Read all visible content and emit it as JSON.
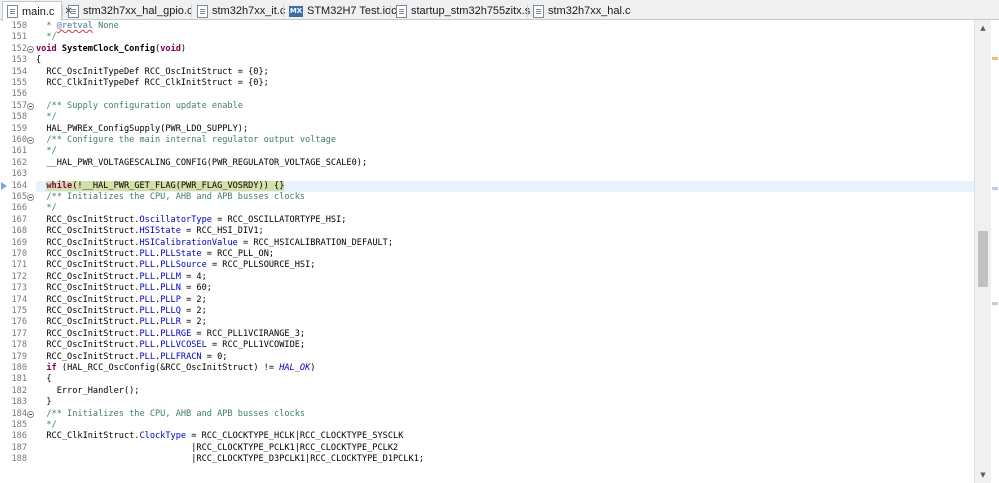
{
  "tabs": [
    {
      "label": "main.c",
      "icon": "c-file-icon",
      "active": true,
      "close": "✕"
    },
    {
      "label": "stm32h7xx_hal_gpio.c",
      "icon": "c-file-icon",
      "active": false
    },
    {
      "label": "stm32h7xx_it.c",
      "icon": "c-file-icon",
      "active": false
    },
    {
      "label": "STM32H7 Test.ioc",
      "icon": "mx-icon",
      "badge": "MX",
      "active": false
    },
    {
      "label": "startup_stm32h755zitx.s",
      "icon": "asm-file-icon",
      "active": false
    },
    {
      "label": "stm32h7xx_hal.c",
      "icon": "c-file-icon",
      "active": false
    }
  ],
  "editor": {
    "current_line": 164,
    "colors": {
      "keyword": "#7f0055",
      "comment": "#3f7f5f",
      "field": "#0000c0",
      "current_line_bg": "#e8f2fe",
      "match_highlight": "#d4e0a8"
    },
    "lines": [
      {
        "n": "150",
        "fold": false,
        "tokens": [
          {
            "t": "  * ",
            "c": "cm"
          },
          {
            "t": "@retval",
            "c": "ann"
          },
          {
            "t": " None",
            "c": "cm"
          }
        ]
      },
      {
        "n": "151",
        "fold": false,
        "tokens": [
          {
            "t": "  */",
            "c": "cm"
          }
        ]
      },
      {
        "n": "152",
        "fold": true,
        "tokens": [
          {
            "t": "void",
            "c": "kw"
          },
          {
            "t": " "
          },
          {
            "t": "SystemClock_Config",
            "c": "bold"
          },
          {
            "t": "("
          },
          {
            "t": "void",
            "c": "kw"
          },
          {
            "t": ")"
          }
        ]
      },
      {
        "n": "153",
        "fold": false,
        "tokens": [
          {
            "t": "{"
          }
        ]
      },
      {
        "n": "154",
        "fold": false,
        "tokens": [
          {
            "t": "  RCC_OscInitTypeDef RCC_OscInitStruct = {0};"
          }
        ]
      },
      {
        "n": "155",
        "fold": false,
        "tokens": [
          {
            "t": "  RCC_ClkInitTypeDef RCC_ClkInitStruct = {0};"
          }
        ]
      },
      {
        "n": "156",
        "fold": false,
        "tokens": [
          {
            "t": ""
          }
        ]
      },
      {
        "n": "157",
        "fold": true,
        "tokens": [
          {
            "t": "  /** Supply configuration update enable",
            "c": "cm"
          }
        ]
      },
      {
        "n": "158",
        "fold": false,
        "tokens": [
          {
            "t": "  */",
            "c": "cm"
          }
        ]
      },
      {
        "n": "159",
        "fold": false,
        "tokens": [
          {
            "t": "  HAL_PWREx_ConfigSupply(PWR_LDO_SUPPLY);"
          }
        ]
      },
      {
        "n": "160",
        "fold": true,
        "tokens": [
          {
            "t": "  /** Configure the main internal regulator output voltage",
            "c": "cm"
          }
        ]
      },
      {
        "n": "161",
        "fold": false,
        "tokens": [
          {
            "t": "  */",
            "c": "cm"
          }
        ]
      },
      {
        "n": "162",
        "fold": false,
        "tokens": [
          {
            "t": "  __HAL_PWR_VOLTAGESCALING_CONFIG(PWR_REGULATOR_VOLTAGE_SCALE0);"
          }
        ]
      },
      {
        "n": "163",
        "fold": false,
        "tokens": [
          {
            "t": ""
          }
        ]
      },
      {
        "n": "164",
        "fold": false,
        "current": true,
        "tokens": [
          {
            "t": "  "
          },
          {
            "t": "while",
            "c": "kw hl"
          },
          {
            "t": "(!__HAL_PWR_GET_FLAG(PWR_FLAG_VOSRDY)) {}",
            "c": "hl"
          }
        ]
      },
      {
        "n": "165",
        "fold": true,
        "tokens": [
          {
            "t": "  /** Initializes the CPU, AHB and APB busses clocks",
            "c": "cm"
          }
        ]
      },
      {
        "n": "166",
        "fold": false,
        "tokens": [
          {
            "t": "  */",
            "c": "cm"
          }
        ]
      },
      {
        "n": "167",
        "fold": false,
        "tokens": [
          {
            "t": "  RCC_OscInitStruct."
          },
          {
            "t": "OscillatorType",
            "c": "fld"
          },
          {
            "t": " = RCC_OSCILLATORTYPE_HSI;"
          }
        ]
      },
      {
        "n": "168",
        "fold": false,
        "tokens": [
          {
            "t": "  RCC_OscInitStruct."
          },
          {
            "t": "HSIState",
            "c": "fld"
          },
          {
            "t": " = RCC_HSI_DIV1;"
          }
        ]
      },
      {
        "n": "169",
        "fold": false,
        "tokens": [
          {
            "t": "  RCC_OscInitStruct."
          },
          {
            "t": "HSICalibrationValue",
            "c": "fld"
          },
          {
            "t": " = RCC_HSICALIBRATION_DEFAULT;"
          }
        ]
      },
      {
        "n": "170",
        "fold": false,
        "tokens": [
          {
            "t": "  RCC_OscInitStruct."
          },
          {
            "t": "PLL",
            "c": "fld"
          },
          {
            "t": "."
          },
          {
            "t": "PLLState",
            "c": "fld"
          },
          {
            "t": " = RCC_PLL_ON;"
          }
        ]
      },
      {
        "n": "171",
        "fold": false,
        "tokens": [
          {
            "t": "  RCC_OscInitStruct."
          },
          {
            "t": "PLL",
            "c": "fld"
          },
          {
            "t": "."
          },
          {
            "t": "PLLSource",
            "c": "fld"
          },
          {
            "t": " = RCC_PLLSOURCE_HSI;"
          }
        ]
      },
      {
        "n": "172",
        "fold": false,
        "tokens": [
          {
            "t": "  RCC_OscInitStruct."
          },
          {
            "t": "PLL",
            "c": "fld"
          },
          {
            "t": "."
          },
          {
            "t": "PLLM",
            "c": "fld"
          },
          {
            "t": " = 4;"
          }
        ]
      },
      {
        "n": "173",
        "fold": false,
        "tokens": [
          {
            "t": "  RCC_OscInitStruct."
          },
          {
            "t": "PLL",
            "c": "fld"
          },
          {
            "t": "."
          },
          {
            "t": "PLLN",
            "c": "fld"
          },
          {
            "t": " = 60;"
          }
        ]
      },
      {
        "n": "174",
        "fold": false,
        "tokens": [
          {
            "t": "  RCC_OscInitStruct."
          },
          {
            "t": "PLL",
            "c": "fld"
          },
          {
            "t": "."
          },
          {
            "t": "PLLP",
            "c": "fld"
          },
          {
            "t": " = 2;"
          }
        ]
      },
      {
        "n": "175",
        "fold": false,
        "tokens": [
          {
            "t": "  RCC_OscInitStruct."
          },
          {
            "t": "PLL",
            "c": "fld"
          },
          {
            "t": "."
          },
          {
            "t": "PLLQ",
            "c": "fld"
          },
          {
            "t": " = 2;"
          }
        ]
      },
      {
        "n": "176",
        "fold": false,
        "tokens": [
          {
            "t": "  RCC_OscInitStruct."
          },
          {
            "t": "PLL",
            "c": "fld"
          },
          {
            "t": "."
          },
          {
            "t": "PLLR",
            "c": "fld"
          },
          {
            "t": " = 2;"
          }
        ]
      },
      {
        "n": "177",
        "fold": false,
        "tokens": [
          {
            "t": "  RCC_OscInitStruct."
          },
          {
            "t": "PLL",
            "c": "fld"
          },
          {
            "t": "."
          },
          {
            "t": "PLLRGE",
            "c": "fld"
          },
          {
            "t": " = RCC_PLL1VCIRANGE_3;"
          }
        ]
      },
      {
        "n": "178",
        "fold": false,
        "tokens": [
          {
            "t": "  RCC_OscInitStruct."
          },
          {
            "t": "PLL",
            "c": "fld"
          },
          {
            "t": "."
          },
          {
            "t": "PLLVCOSEL",
            "c": "fld"
          },
          {
            "t": " = RCC_PLL1VCOWIDE;"
          }
        ]
      },
      {
        "n": "179",
        "fold": false,
        "tokens": [
          {
            "t": "  RCC_OscInitStruct."
          },
          {
            "t": "PLL",
            "c": "fld"
          },
          {
            "t": "."
          },
          {
            "t": "PLLFRACN",
            "c": "fld"
          },
          {
            "t": " = 0;"
          }
        ]
      },
      {
        "n": "180",
        "fold": false,
        "tokens": [
          {
            "t": "  "
          },
          {
            "t": "if",
            "c": "kw"
          },
          {
            "t": " (HAL_RCC_OscConfig(&RCC_OscInitStruct) != "
          },
          {
            "t": "HAL_OK",
            "c": "con"
          },
          {
            "t": ")"
          }
        ]
      },
      {
        "n": "181",
        "fold": false,
        "tokens": [
          {
            "t": "  {"
          }
        ]
      },
      {
        "n": "182",
        "fold": false,
        "tokens": [
          {
            "t": "    Error_Handler();"
          }
        ]
      },
      {
        "n": "183",
        "fold": false,
        "tokens": [
          {
            "t": "  }"
          }
        ]
      },
      {
        "n": "184",
        "fold": true,
        "tokens": [
          {
            "t": "  /** Initializes the CPU, AHB and APB busses clocks",
            "c": "cm"
          }
        ]
      },
      {
        "n": "185",
        "fold": false,
        "tokens": [
          {
            "t": "  */",
            "c": "cm"
          }
        ]
      },
      {
        "n": "186",
        "fold": false,
        "tokens": [
          {
            "t": "  RCC_ClkInitStruct."
          },
          {
            "t": "ClockType",
            "c": "fld"
          },
          {
            "t": " = RCC_CLOCKTYPE_HCLK|RCC_CLOCKTYPE_SYSCLK"
          }
        ]
      },
      {
        "n": "187",
        "fold": false,
        "tokens": [
          {
            "t": "                              |RCC_CLOCKTYPE_PCLK1|RCC_CLOCKTYPE_PCLK2"
          }
        ]
      },
      {
        "n": "188",
        "fold": false,
        "tokens": [
          {
            "t": "                              |RCC_CLOCKTYPE_D3PCLK1|RCC_CLOCKTYPE_D1PCLK1;"
          }
        ]
      }
    ]
  },
  "scrollbar": {
    "position": 0.52,
    "visible_fraction": 0.13,
    "up_glyph": "▲",
    "down_glyph": "▼"
  },
  "overview_marks": [
    {
      "pos": 0.08,
      "color": "#e8c07a"
    },
    {
      "pos": 0.36,
      "color": "#b8cfe8"
    },
    {
      "pos": 0.61,
      "color": "#b8cfe8"
    }
  ]
}
